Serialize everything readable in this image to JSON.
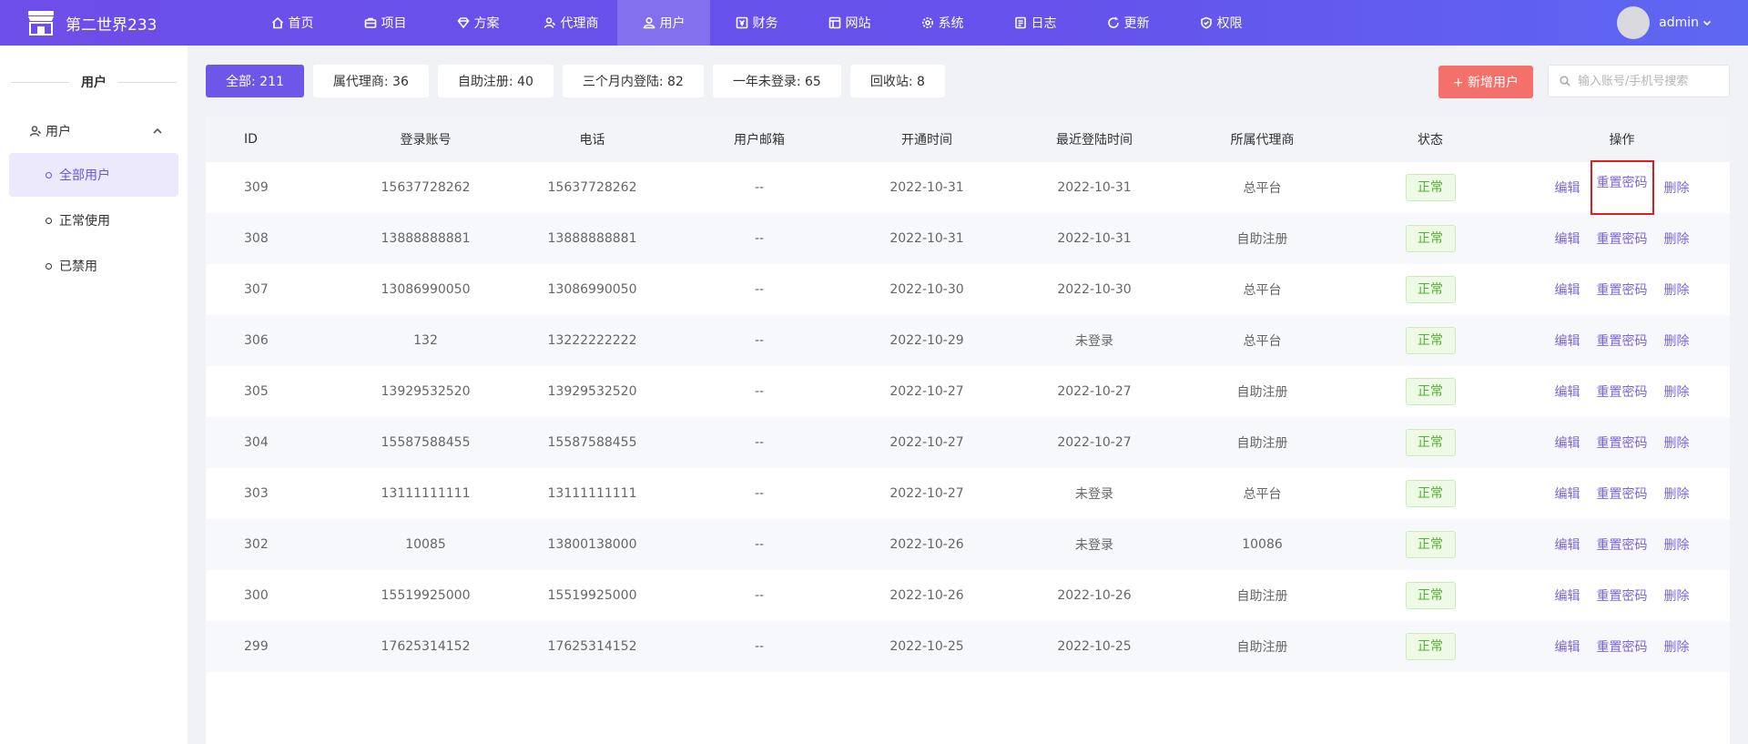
{
  "app": {
    "title": "第二世界233"
  },
  "nav": [
    {
      "label": "首页",
      "icon": "home-icon"
    },
    {
      "label": "项目",
      "icon": "briefcase-icon"
    },
    {
      "label": "方案",
      "icon": "diamond-icon"
    },
    {
      "label": "代理商",
      "icon": "agent-icon"
    },
    {
      "label": "用户",
      "icon": "user-icon"
    },
    {
      "label": "财务",
      "icon": "finance-icon"
    },
    {
      "label": "网站",
      "icon": "website-icon"
    },
    {
      "label": "系统",
      "icon": "gear-icon"
    },
    {
      "label": "日志",
      "icon": "log-icon"
    },
    {
      "label": "更新",
      "icon": "refresh-icon"
    },
    {
      "label": "权限",
      "icon": "shield-check-icon"
    }
  ],
  "user": {
    "name": "admin"
  },
  "sidebar": {
    "title": "用户",
    "group": "用户",
    "items": [
      {
        "label": "全部用户"
      },
      {
        "label": "正常使用"
      },
      {
        "label": "已禁用"
      }
    ]
  },
  "filters": [
    {
      "label": "全部: 211"
    },
    {
      "label": "属代理商: 36"
    },
    {
      "label": "自助注册: 40"
    },
    {
      "label": "三个月内登陆: 82"
    },
    {
      "label": "一年未登录: 65"
    },
    {
      "label": "回收站: 8"
    }
  ],
  "toolbar": {
    "add_label": "+ 新增用户",
    "search_placeholder": "输入账号/手机号搜索"
  },
  "table": {
    "headers": [
      "ID",
      "登录账号",
      "电话",
      "用户邮箱",
      "开通时间",
      "最近登陆时间",
      "所属代理商",
      "状态",
      "操作"
    ],
    "op_labels": {
      "edit": "编辑",
      "reset": "重置密码",
      "delete": "删除"
    },
    "rows": [
      {
        "id": "309",
        "account": "15637728262",
        "phone": "15637728262",
        "email": "--",
        "opened": "2022-10-31",
        "last_login": "2022-10-31",
        "agent": "总平台",
        "status": "正常"
      },
      {
        "id": "308",
        "account": "13888888881",
        "phone": "13888888881",
        "email": "--",
        "opened": "2022-10-31",
        "last_login": "2022-10-31",
        "agent": "自助注册",
        "status": "正常"
      },
      {
        "id": "307",
        "account": "13086990050",
        "phone": "13086990050",
        "email": "--",
        "opened": "2022-10-30",
        "last_login": "2022-10-30",
        "agent": "总平台",
        "status": "正常"
      },
      {
        "id": "306",
        "account": "132",
        "phone": "13222222222",
        "email": "--",
        "opened": "2022-10-29",
        "last_login": "未登录",
        "agent": "总平台",
        "status": "正常"
      },
      {
        "id": "305",
        "account": "13929532520",
        "phone": "13929532520",
        "email": "--",
        "opened": "2022-10-27",
        "last_login": "2022-10-27",
        "agent": "自助注册",
        "status": "正常"
      },
      {
        "id": "304",
        "account": "15587588455",
        "phone": "15587588455",
        "email": "--",
        "opened": "2022-10-27",
        "last_login": "2022-10-27",
        "agent": "自助注册",
        "status": "正常"
      },
      {
        "id": "303",
        "account": "13111111111",
        "phone": "13111111111",
        "email": "--",
        "opened": "2022-10-27",
        "last_login": "未登录",
        "agent": "总平台",
        "status": "正常"
      },
      {
        "id": "302",
        "account": "10085",
        "phone": "13800138000",
        "email": "--",
        "opened": "2022-10-26",
        "last_login": "未登录",
        "agent": "10086",
        "status": "正常"
      },
      {
        "id": "300",
        "account": "15519925000",
        "phone": "15519925000",
        "email": "--",
        "opened": "2022-10-26",
        "last_login": "2022-10-26",
        "agent": "自助注册",
        "status": "正常"
      },
      {
        "id": "299",
        "account": "17625314152",
        "phone": "17625314152",
        "email": "--",
        "opened": "2022-10-25",
        "last_login": "2022-10-25",
        "agent": "自助注册",
        "status": "正常"
      }
    ]
  }
}
